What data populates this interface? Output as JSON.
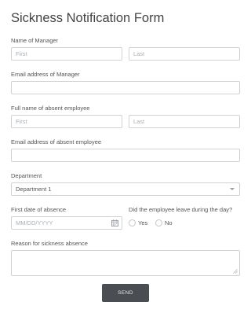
{
  "form": {
    "title": "Sickness Notification Form",
    "manager_name": {
      "label": "Name of Manager",
      "first_placeholder": "First",
      "last_placeholder": "Last"
    },
    "manager_email": {
      "label": "Email address of Manager",
      "value": ""
    },
    "employee_name": {
      "label": "Full name of absent employee",
      "first_placeholder": "First",
      "last_placeholder": "Last"
    },
    "employee_email": {
      "label": "Email address of absent employee",
      "value": ""
    },
    "department": {
      "label": "Department",
      "selected": "Department 1"
    },
    "first_date": {
      "label": "First date of absence",
      "placeholder": "MM/DD/YYYY"
    },
    "left_during_day": {
      "label": "Did the employee leave during the day?",
      "options": [
        "Yes",
        "No"
      ]
    },
    "reason": {
      "label": "Reason for sickness absence"
    },
    "submit_label": "SEND"
  }
}
